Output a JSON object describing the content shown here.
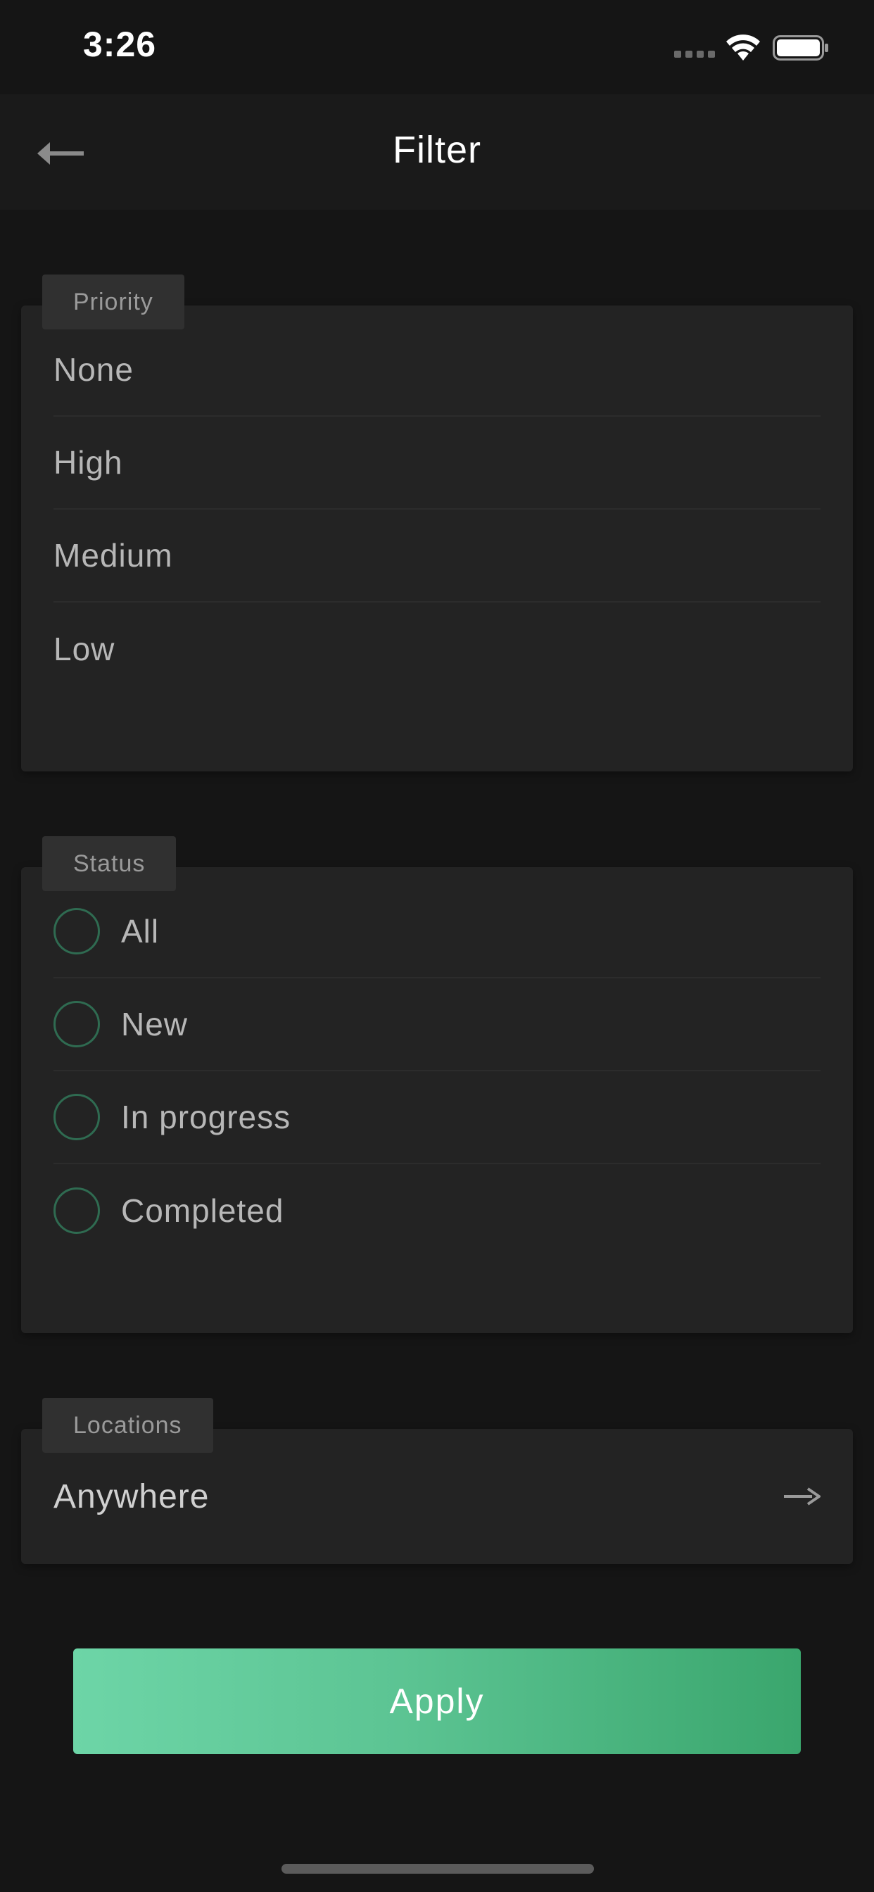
{
  "status_bar": {
    "time": "3:26"
  },
  "nav": {
    "title": "Filter",
    "back_icon": "arrow-left-icon"
  },
  "priority": {
    "tag": "Priority",
    "options": [
      "None",
      "High",
      "Medium",
      "Low"
    ]
  },
  "status": {
    "tag": "Status",
    "options": [
      "All",
      "New",
      "In progress",
      "Completed"
    ],
    "radio_color": "#2f6b51"
  },
  "locations": {
    "tag": "Locations",
    "value": "Anywhere",
    "arrow_icon": "arrow-right-icon"
  },
  "apply": {
    "label": "Apply",
    "gradient": [
      "#6dd5a7",
      "#3aa66d"
    ]
  }
}
